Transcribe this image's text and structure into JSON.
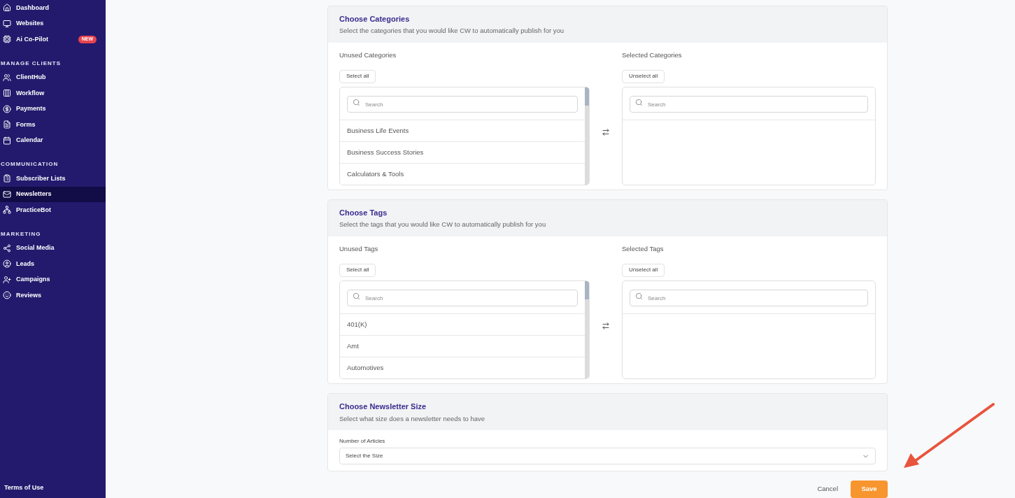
{
  "sidebar": {
    "sections": [
      {
        "items": [
          {
            "label": "Dashboard",
            "selected": false
          },
          {
            "label": "Websites",
            "selected": false
          },
          {
            "label": "Ai Co-Pilot",
            "selected": false,
            "badge": "NEW"
          }
        ]
      },
      {
        "heading": "MANAGE CLIENTS",
        "items": [
          {
            "label": "ClientHub",
            "selected": false
          },
          {
            "label": "Workflow",
            "selected": false
          },
          {
            "label": "Payments",
            "selected": false
          },
          {
            "label": "Forms",
            "selected": false
          },
          {
            "label": "Calendar",
            "selected": false
          }
        ]
      },
      {
        "heading": "COMMUNICATION",
        "items": [
          {
            "label": "Subscriber Lists",
            "selected": false
          },
          {
            "label": "Newsletters",
            "selected": true
          },
          {
            "label": "PracticeBot",
            "selected": false
          }
        ]
      },
      {
        "heading": "MARKETING",
        "items": [
          {
            "label": "Social Media",
            "selected": false
          },
          {
            "label": "Leads",
            "selected": false
          },
          {
            "label": "Campaigns",
            "selected": false
          },
          {
            "label": "Reviews",
            "selected": false
          }
        ]
      }
    ],
    "footer": "Terms of Use"
  },
  "transfer_panels": [
    {
      "title": "Choose Categories",
      "subtitle": "Select the categories that you would like CW to automatically publish for you",
      "unused": {
        "label": "Unused Categories",
        "button": "Select all",
        "search_placeholder": "Search",
        "items": [
          "Business Life Events",
          "Business Success Stories",
          "Calculators & Tools"
        ]
      },
      "selected": {
        "label": "Selected Categories",
        "button": "Unselect all",
        "search_placeholder": "Search"
      }
    },
    {
      "title": "Choose Tags",
      "subtitle": "Select the tags that you would like CW to automatically publish for you",
      "unused": {
        "label": "Unused Tags",
        "button": "Select all",
        "search_placeholder": "Search",
        "items": [
          "401(K)",
          "Amt",
          "Automotives"
        ]
      },
      "selected": {
        "label": "Selected Tags",
        "button": "Unselect all",
        "search_placeholder": "Search"
      }
    }
  ],
  "size_panel": {
    "title": "Choose Newsletter Size",
    "subtitle": "Select what size does a newsletter needs to have",
    "field_label": "Number of Articles",
    "placeholder": "Select the Size"
  },
  "actions": {
    "cancel": "Cancel",
    "save": "Save"
  }
}
